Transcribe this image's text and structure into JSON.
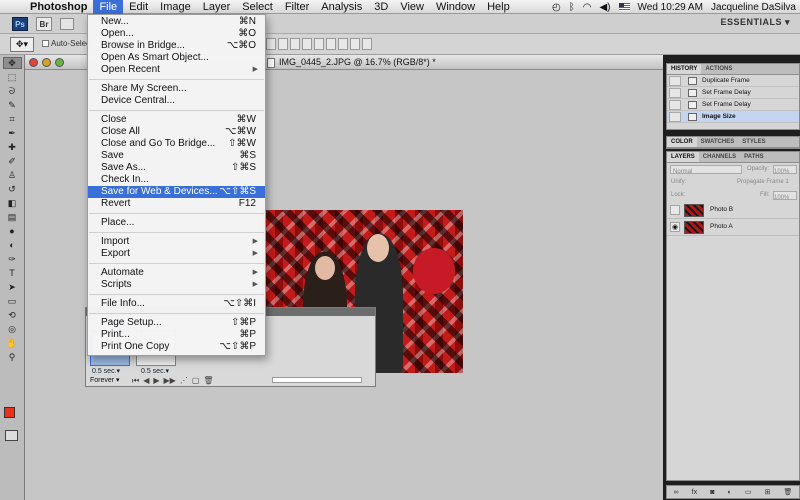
{
  "menubar": {
    "app_name": "Photoshop",
    "menus": [
      "File",
      "Edit",
      "Image",
      "Layer",
      "Select",
      "Filter",
      "Analysis",
      "3D",
      "View",
      "Window",
      "Help"
    ],
    "active_menu": "File",
    "clock": "Wed 10:29 AM",
    "user": "Jacqueline DaSilva",
    "status_icons": [
      "time-machine-icon",
      "bluetooth-icon",
      "wifi-icon",
      "volume-icon",
      "flag-icon"
    ]
  },
  "appbar": {
    "ps_label": "Ps",
    "br_label": "Br",
    "workspace": "ESSENTIALS ▾"
  },
  "options": {
    "auto_select": "Auto-Select"
  },
  "document": {
    "title": "IMG_0445_2.JPG @ 16.7% (RGB/8*) *"
  },
  "file_menu": {
    "groups": [
      [
        {
          "label": "New...",
          "shortcut": "⌘N"
        },
        {
          "label": "Open...",
          "shortcut": "⌘O"
        },
        {
          "label": "Browse in Bridge...",
          "shortcut": "⌥⌘O"
        },
        {
          "label": "Open As Smart Object...",
          "shortcut": ""
        },
        {
          "label": "Open Recent",
          "shortcut": "",
          "submenu": true
        }
      ],
      [
        {
          "label": "Share My Screen...",
          "shortcut": ""
        },
        {
          "label": "Device Central...",
          "shortcut": ""
        }
      ],
      [
        {
          "label": "Close",
          "shortcut": "⌘W"
        },
        {
          "label": "Close All",
          "shortcut": "⌥⌘W"
        },
        {
          "label": "Close and Go To Bridge...",
          "shortcut": "⇧⌘W"
        },
        {
          "label": "Save",
          "shortcut": "⌘S"
        },
        {
          "label": "Save As...",
          "shortcut": "⇧⌘S"
        },
        {
          "label": "Check In...",
          "shortcut": ""
        },
        {
          "label": "Save for Web & Devices...",
          "shortcut": "⌥⇧⌘S",
          "highlighted": true
        },
        {
          "label": "Revert",
          "shortcut": "F12"
        }
      ],
      [
        {
          "label": "Place...",
          "shortcut": ""
        }
      ],
      [
        {
          "label": "Import",
          "shortcut": "",
          "submenu": true
        },
        {
          "label": "Export",
          "shortcut": "",
          "submenu": true
        }
      ],
      [
        {
          "label": "Automate",
          "shortcut": "",
          "submenu": true
        },
        {
          "label": "Scripts",
          "shortcut": "",
          "submenu": true
        }
      ],
      [
        {
          "label": "File Info...",
          "shortcut": "⌥⇧⌘I"
        }
      ],
      [
        {
          "label": "Page Setup...",
          "shortcut": "⇧⌘P"
        },
        {
          "label": "Print...",
          "shortcut": "⌘P"
        },
        {
          "label": "Print One Copy",
          "shortcut": "⌥⇧⌘P"
        }
      ]
    ]
  },
  "animation": {
    "frames": [
      {
        "num": "1",
        "delay": "0.5 sec.▾",
        "selected": true
      },
      {
        "num": "2",
        "delay": "0.5 sec.▾",
        "selected": false
      }
    ],
    "loop": "Forever ▾"
  },
  "history": {
    "tabs": [
      "HISTORY",
      "ACTIONS"
    ],
    "items": [
      {
        "label": "Duplicate Frame"
      },
      {
        "label": "Set Frame Delay"
      },
      {
        "label": "Set Frame Delay"
      },
      {
        "label": "Image Size",
        "current": true
      }
    ]
  },
  "color_tabs": [
    "COLOR",
    "SWATCHES",
    "STYLES"
  ],
  "layers": {
    "tabs": [
      "LAYERS",
      "CHANNELS",
      "PATHS"
    ],
    "blend_mode": "Normal",
    "opacity_label": "Opacity:",
    "opacity_value": "100%",
    "unify_label": "Unify:",
    "propagate_label": "Propagate Frame 1",
    "lock_label": "Lock:",
    "fill_label": "Fill:",
    "fill_value": "100%",
    "items": [
      {
        "name": "Photo B",
        "visible": false
      },
      {
        "name": "Photo A",
        "visible": true
      }
    ]
  },
  "colors": {
    "foreground": "#e8321e",
    "background": "#ffffff",
    "highlight": "#3a6fd8"
  }
}
